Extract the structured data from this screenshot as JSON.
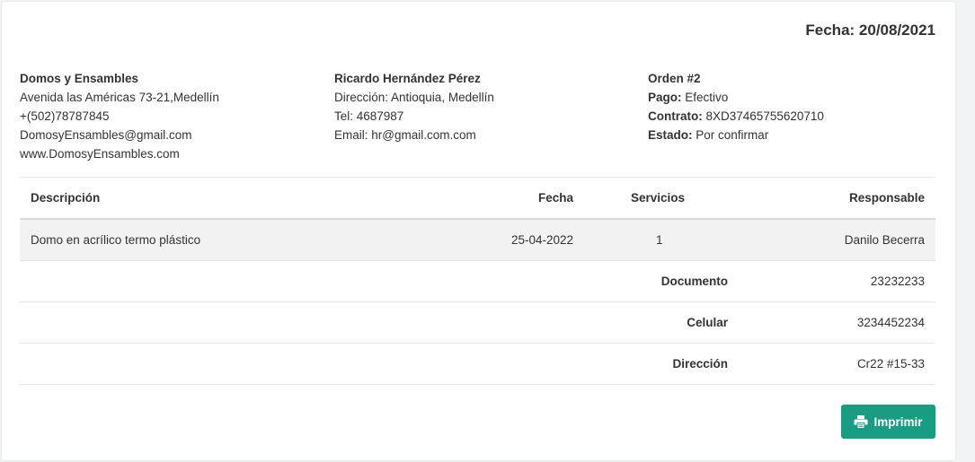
{
  "header": {
    "date_label": "Fecha: 20/08/2021"
  },
  "company": {
    "name": "Domos y Ensambles",
    "address": "Avenida las Américas 73-21,Medellín",
    "phone": "+(502)78787845",
    "email": "DomosyEnsambles@gmail.com",
    "web": "www.DomosyEnsambles.com"
  },
  "client": {
    "name": "Ricardo Hernández Pérez",
    "address": "Dirección: Antioquia, Medellín",
    "phone": "Tel: 4687987",
    "email": "Email: hr@gmail.com.com"
  },
  "order": {
    "title": "Orden #2",
    "pago_label": "Pago:",
    "pago_value": "Efectivo",
    "contrato_label": "Contrato:",
    "contrato_value": "8XD37465755620710",
    "estado_label": "Estado:",
    "estado_value": "Por confirmar"
  },
  "table": {
    "headers": {
      "descripcion": "Descripción",
      "fecha": "Fecha",
      "servicios": "Servicios",
      "responsable": "Responsable"
    },
    "row": {
      "descripcion": "Domo en acrílico termo plástico",
      "fecha": "25-04-2022",
      "servicios": "1",
      "responsable": "Danilo Becerra"
    },
    "details": [
      {
        "label": "Documento",
        "value": "23232233"
      },
      {
        "label": "Celular",
        "value": "3234452234"
      },
      {
        "label": "Dirección",
        "value": "Cr22 #15-33"
      }
    ]
  },
  "actions": {
    "print_label": "Imprimir",
    "print_icon": "printer-icon",
    "accent": "#1a9c82"
  }
}
